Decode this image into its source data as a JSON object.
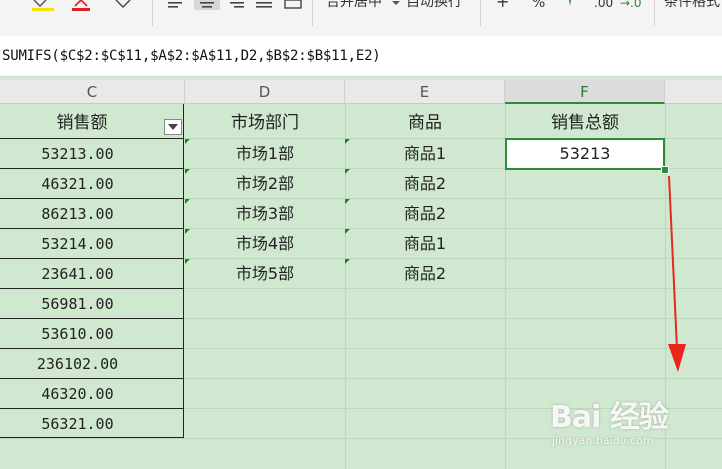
{
  "toolbar": {
    "merge_center": "合并居中",
    "wrap_text": "自动换行",
    "percent": "%",
    "decimal_label": ".00",
    "decimal_arrow": "→.0",
    "conditional_format": "条件格式"
  },
  "formula_bar": {
    "formula": "SUMIFS($C$2:$C$11,$A$2:$A$11,D2,$B$2:$B$11,E2)"
  },
  "columns": [
    {
      "letter": "C"
    },
    {
      "letter": "D"
    },
    {
      "letter": "E"
    },
    {
      "letter": "F"
    }
  ],
  "headers": {
    "c": "销售额",
    "d": "市场部门",
    "e": "商品",
    "f": "销售总额"
  },
  "sales_values": [
    "53213.00",
    "46321.00",
    "86213.00",
    "53214.00",
    "23641.00",
    "56981.00",
    "53610.00",
    "236102.00",
    "46320.00",
    "56321.00"
  ],
  "criteria_rows": [
    {
      "dept": "市场1部",
      "product": "商品1"
    },
    {
      "dept": "市场2部",
      "product": "商品2"
    },
    {
      "dept": "市场3部",
      "product": "商品2"
    },
    {
      "dept": "市场4部",
      "product": "商品1"
    },
    {
      "dept": "市场5部",
      "product": "商品2"
    }
  ],
  "result": {
    "f2": "53213"
  },
  "accent_color": "#2e8b3a",
  "arrow_color": "#e8261c",
  "watermark": {
    "main": "Bai 经验",
    "sub": "jingyan.baidu.com"
  }
}
